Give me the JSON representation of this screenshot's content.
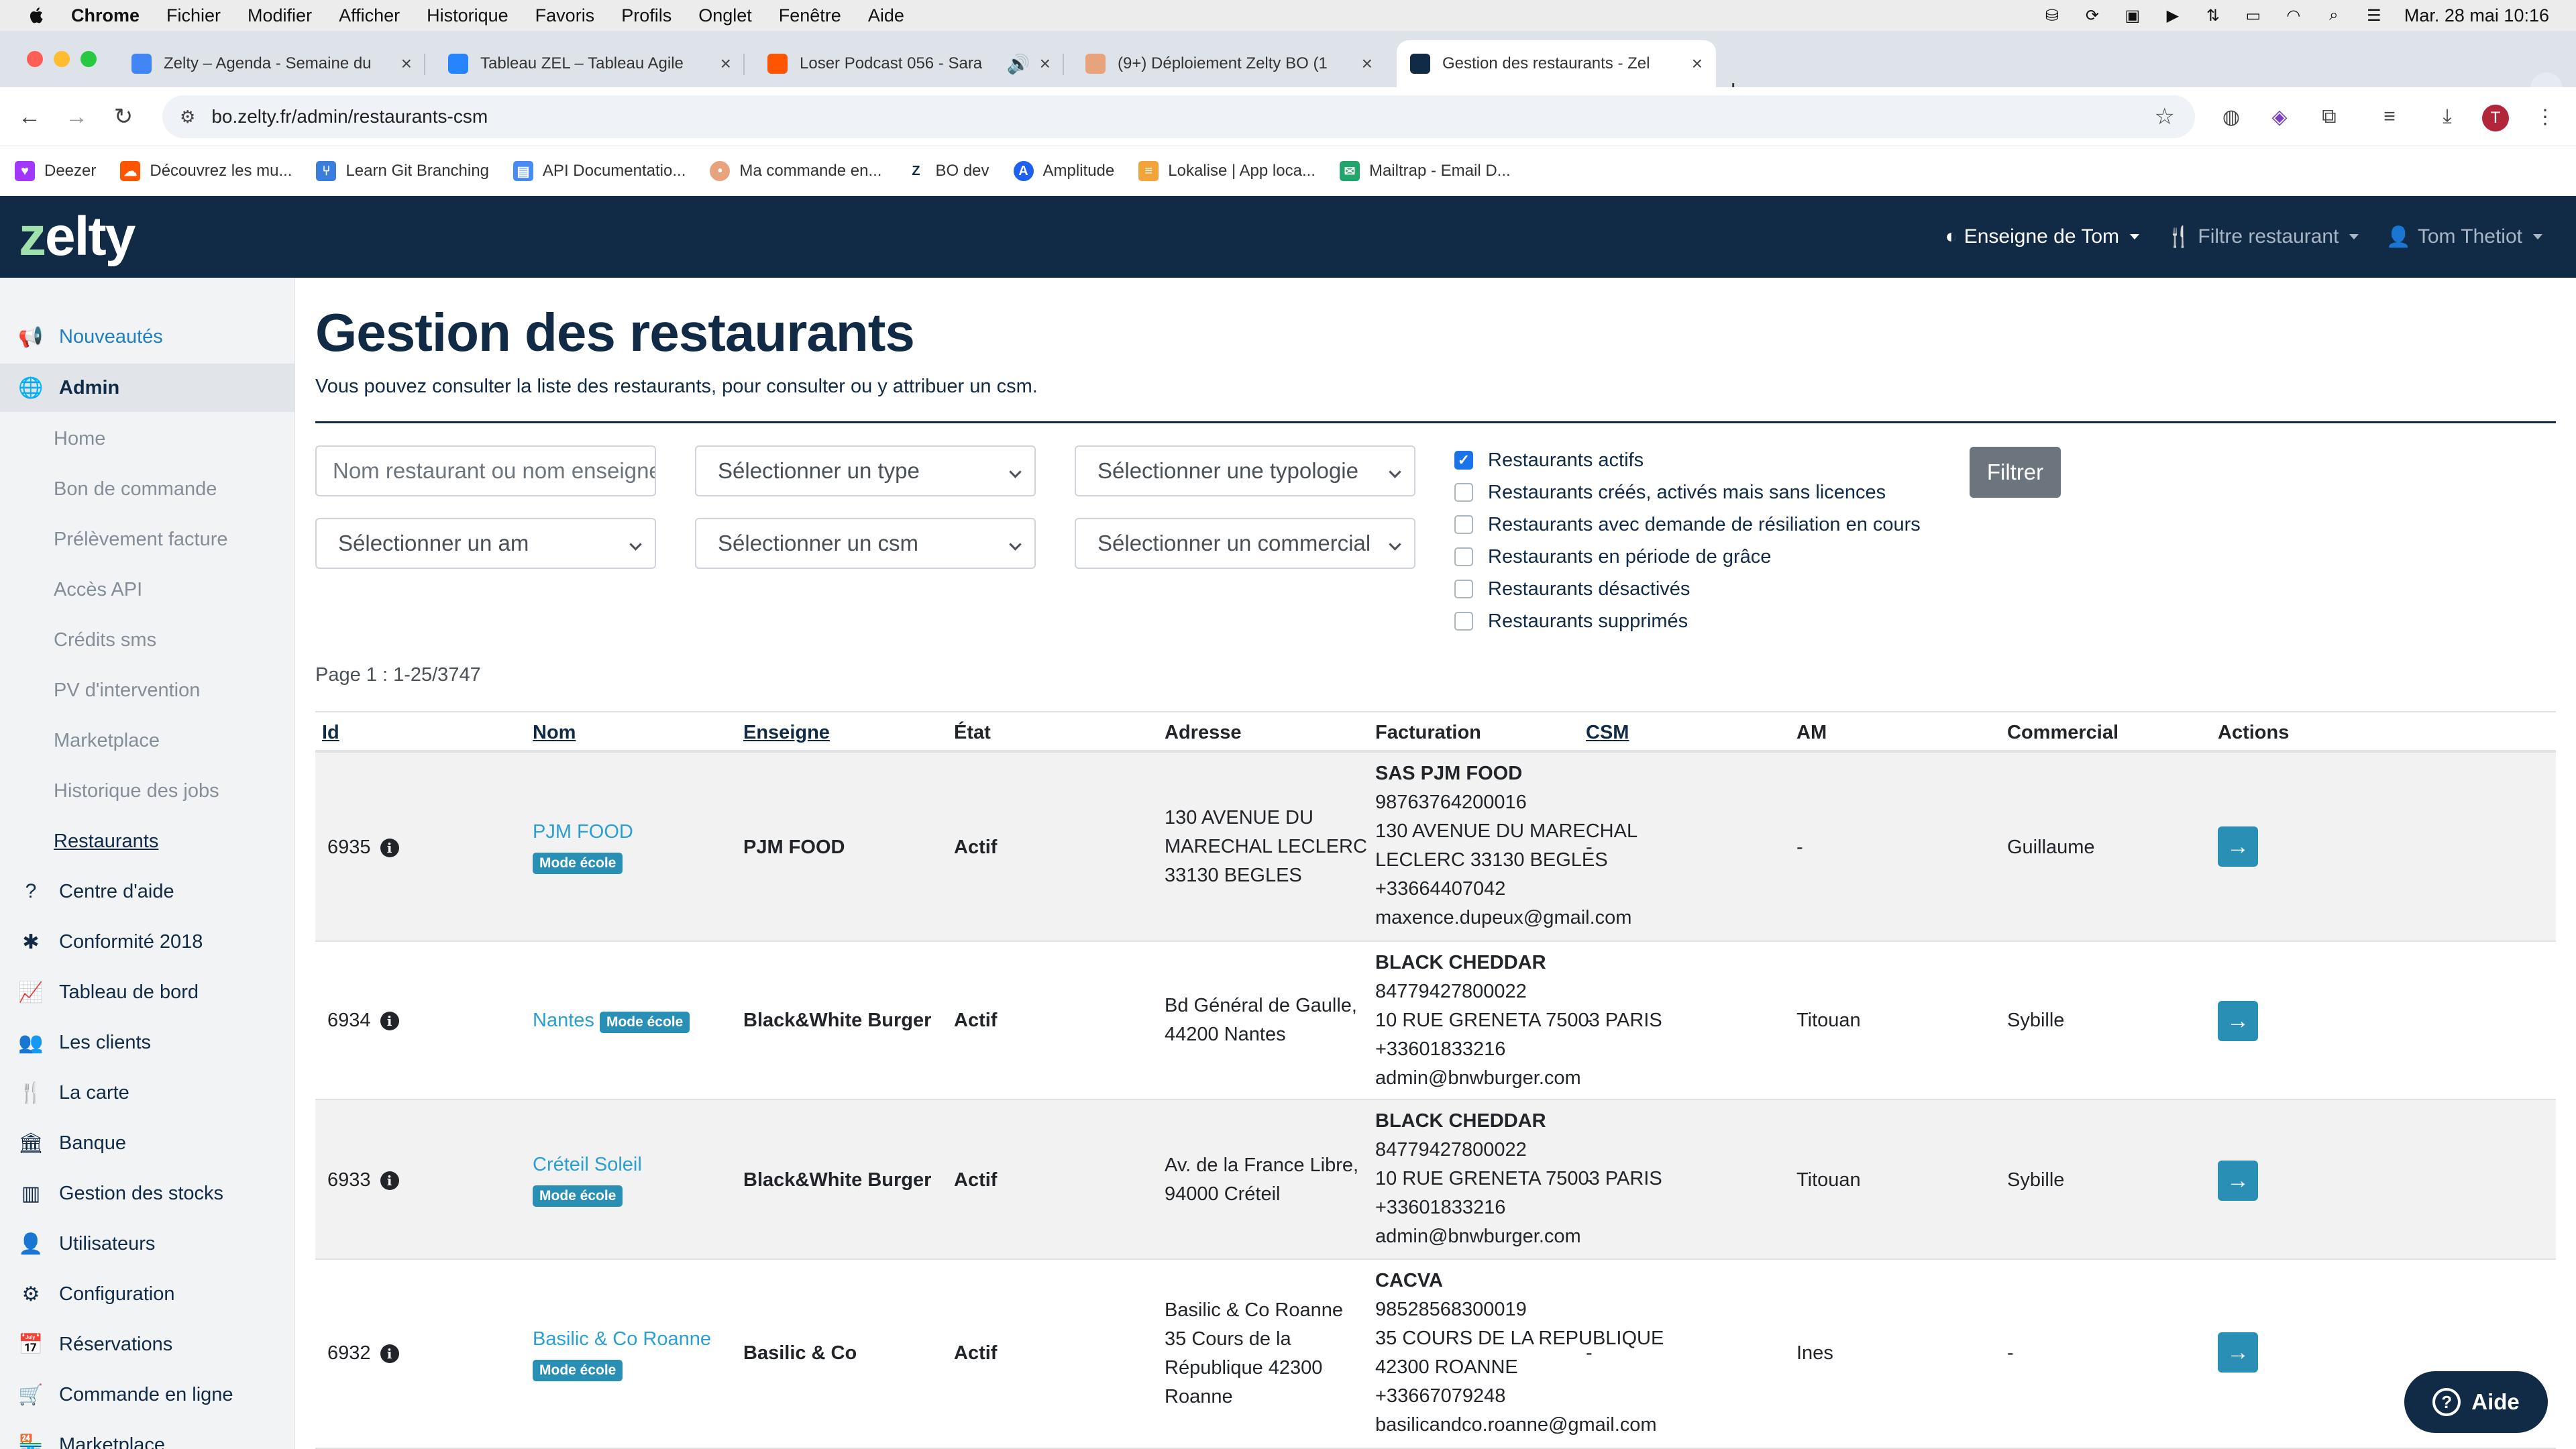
{
  "os_menubar": {
    "app": "Chrome",
    "items": [
      "Fichier",
      "Modifier",
      "Afficher",
      "Historique",
      "Favoris",
      "Profils",
      "Onglet",
      "Fenêtre",
      "Aide"
    ],
    "datetime": "Mar. 28 mai  10:16"
  },
  "tabs": [
    {
      "title": "Zelty – Agenda - Semaine du",
      "favicon_color": "#4285f4",
      "active": false
    },
    {
      "title": "Tableau ZEL – Tableau Agile",
      "favicon_color": "#2684ff",
      "active": false
    },
    {
      "title": "Loser Podcast 056 - Sara",
      "favicon_color": "#ff5500",
      "active": false
    },
    {
      "title": "(9+) Déploiement Zelty BO (1",
      "favicon_color": "#e8a27c",
      "active": false
    },
    {
      "title": "Gestion des restaurants - Zel",
      "favicon_color": "#112a46",
      "active": true
    }
  ],
  "address_bar": {
    "url": "bo.zelty.fr/admin/restaurants-csm"
  },
  "bookmarks": [
    {
      "label": "Deezer",
      "color": "#a238ff"
    },
    {
      "label": "Découvrez les mu...",
      "color": "#ff5500"
    },
    {
      "label": "Learn Git Branching",
      "color": "#3b7ddd"
    },
    {
      "label": "API Documentatio...",
      "color": "#4a8af4"
    },
    {
      "label": "Ma commande en...",
      "color": "#e8a27c"
    },
    {
      "label": "BO dev",
      "color": "#112a46"
    },
    {
      "label": "Amplitude",
      "color": "#1e61f0"
    },
    {
      "label": "Lokalise | App loca...",
      "color": "#f2a33a"
    },
    {
      "label": "Mailtrap - Email D...",
      "color": "#22a56b"
    }
  ],
  "header": {
    "logo": "zelty",
    "brand_menu": "Enseigne de Tom",
    "restaurant_filter": "Filtre restaurant",
    "user_menu": "Tom Thetiot"
  },
  "sidebar": {
    "items": [
      {
        "label": "Nouveautés",
        "icon": "megaphone-icon",
        "glyph": "📢"
      },
      {
        "label": "Admin",
        "icon": "globe-icon",
        "glyph": "🌐"
      },
      {
        "label": "Home"
      },
      {
        "label": "Bon de commande"
      },
      {
        "label": "Prélèvement facture"
      },
      {
        "label": "Accès API"
      },
      {
        "label": "Crédits sms"
      },
      {
        "label": "PV d'intervention"
      },
      {
        "label": "Marketplace"
      },
      {
        "label": "Historique des jobs"
      },
      {
        "label": "Restaurants"
      },
      {
        "label": "Centre d'aide",
        "icon": "question-icon",
        "glyph": "?"
      },
      {
        "label": "Conformité 2018",
        "icon": "asterisk-icon",
        "glyph": "✱"
      },
      {
        "label": "Tableau de bord",
        "icon": "chart-icon",
        "glyph": "📈"
      },
      {
        "label": "Les clients",
        "icon": "users-icon",
        "glyph": "👥"
      },
      {
        "label": "La carte",
        "icon": "utensils-icon",
        "glyph": "🍴"
      },
      {
        "label": "Banque",
        "icon": "bank-icon",
        "glyph": "🏛"
      },
      {
        "label": "Gestion des stocks",
        "icon": "barcode-icon",
        "glyph": "▥"
      },
      {
        "label": "Utilisateurs",
        "icon": "user-card-icon",
        "glyph": "👤"
      },
      {
        "label": "Configuration",
        "icon": "cog-icon",
        "glyph": "⚙"
      },
      {
        "label": "Réservations",
        "icon": "calendar-icon",
        "glyph": "📅"
      },
      {
        "label": "Commande en ligne",
        "icon": "cart-icon",
        "glyph": "🛒"
      },
      {
        "label": "Marketplace",
        "icon": "store-icon",
        "glyph": "🏪"
      }
    ]
  },
  "page": {
    "title": "Gestion des restaurants",
    "subtitle": "Vous pouvez consulter la liste des restaurants, pour consulter ou y attribuer un csm."
  },
  "filters": {
    "search_placeholder": "Nom restaurant ou nom enseigne",
    "type": "Sélectionner un type",
    "typology": "Sélectionner une typologie",
    "am": "Sélectionner un am",
    "csm": "Sélectionner un csm",
    "commercial": "Sélectionner un commercial",
    "checkboxes": [
      {
        "label": "Restaurants actifs",
        "checked": true
      },
      {
        "label": "Restaurants créés, activés mais sans licences",
        "checked": false
      },
      {
        "label": "Restaurants avec demande de résiliation en cours",
        "checked": false
      },
      {
        "label": "Restaurants en période de grâce",
        "checked": false
      },
      {
        "label": "Restaurants désactivés",
        "checked": false
      },
      {
        "label": "Restaurants supprimés",
        "checked": false
      }
    ],
    "submit_label": "Filtrer"
  },
  "pagination": {
    "label": "Page 1 : 1-25/3747"
  },
  "table": {
    "columns": [
      "Id",
      "Nom",
      "Enseigne",
      "État",
      "Adresse",
      "Facturation",
      "CSM",
      "AM",
      "Commercial",
      "Actions"
    ],
    "rows": [
      {
        "id": "6935",
        "nom": "PJM FOOD",
        "badge": "Mode école",
        "enseigne": "PJM FOOD",
        "etat": "Actif",
        "adresse": [
          "130 AVENUE DU",
          "MARECHAL LECLERC",
          "33130 BEGLES"
        ],
        "facturation_title": "SAS PJM FOOD",
        "facturation": [
          "98763764200016",
          "130 AVENUE DU MARECHAL",
          "LECLERC 33130 BEGLES",
          "+33664407042",
          "maxence.dupeux@gmail.com"
        ],
        "csm": "-",
        "am": "-",
        "commercial": "Guillaume"
      },
      {
        "id": "6934",
        "nom": "Nantes",
        "badge": "Mode école",
        "enseigne": "Black&White Burger",
        "etat": "Actif",
        "adresse": [
          "Bd Général de Gaulle,",
          "44200 Nantes"
        ],
        "facturation_title": "BLACK CHEDDAR",
        "facturation": [
          "84779427800022",
          "10 RUE GRENETA 75003 PARIS",
          "+33601833216",
          "admin@bnwburger.com"
        ],
        "csm": "-",
        "am": "Titouan",
        "commercial": "Sybille"
      },
      {
        "id": "6933",
        "nom": "Créteil Soleil",
        "badge": "Mode école",
        "enseigne": "Black&White Burger",
        "etat": "Actif",
        "adresse": [
          "Av. de la France Libre,",
          "94000 Créteil"
        ],
        "facturation_title": "BLACK CHEDDAR",
        "facturation": [
          "84779427800022",
          "10 RUE GRENETA 75003 PARIS",
          "+33601833216",
          "admin@bnwburger.com"
        ],
        "csm": "-",
        "am": "Titouan",
        "commercial": "Sybille"
      },
      {
        "id": "6932",
        "nom": "Basilic & Co Roanne",
        "badge": "Mode école",
        "enseigne": "Basilic & Co",
        "etat": "Actif",
        "adresse": [
          "Basilic & Co Roanne",
          "35 Cours de la",
          "République 42300",
          "Roanne"
        ],
        "facturation_title": "CACVA",
        "facturation": [
          "98528568300019",
          "35 COURS DE LA REPUBLIQUE",
          "42300 ROANNE",
          "+33667079248",
          "basilicandco.roanne@gmail.com"
        ],
        "csm": "-",
        "am": "Ines",
        "commercial": "-"
      }
    ]
  },
  "help_button": {
    "label": "Aide"
  },
  "colors": {
    "navy": "#112a46",
    "accent": "#2a8fb5",
    "link": "#2a9fd6"
  }
}
